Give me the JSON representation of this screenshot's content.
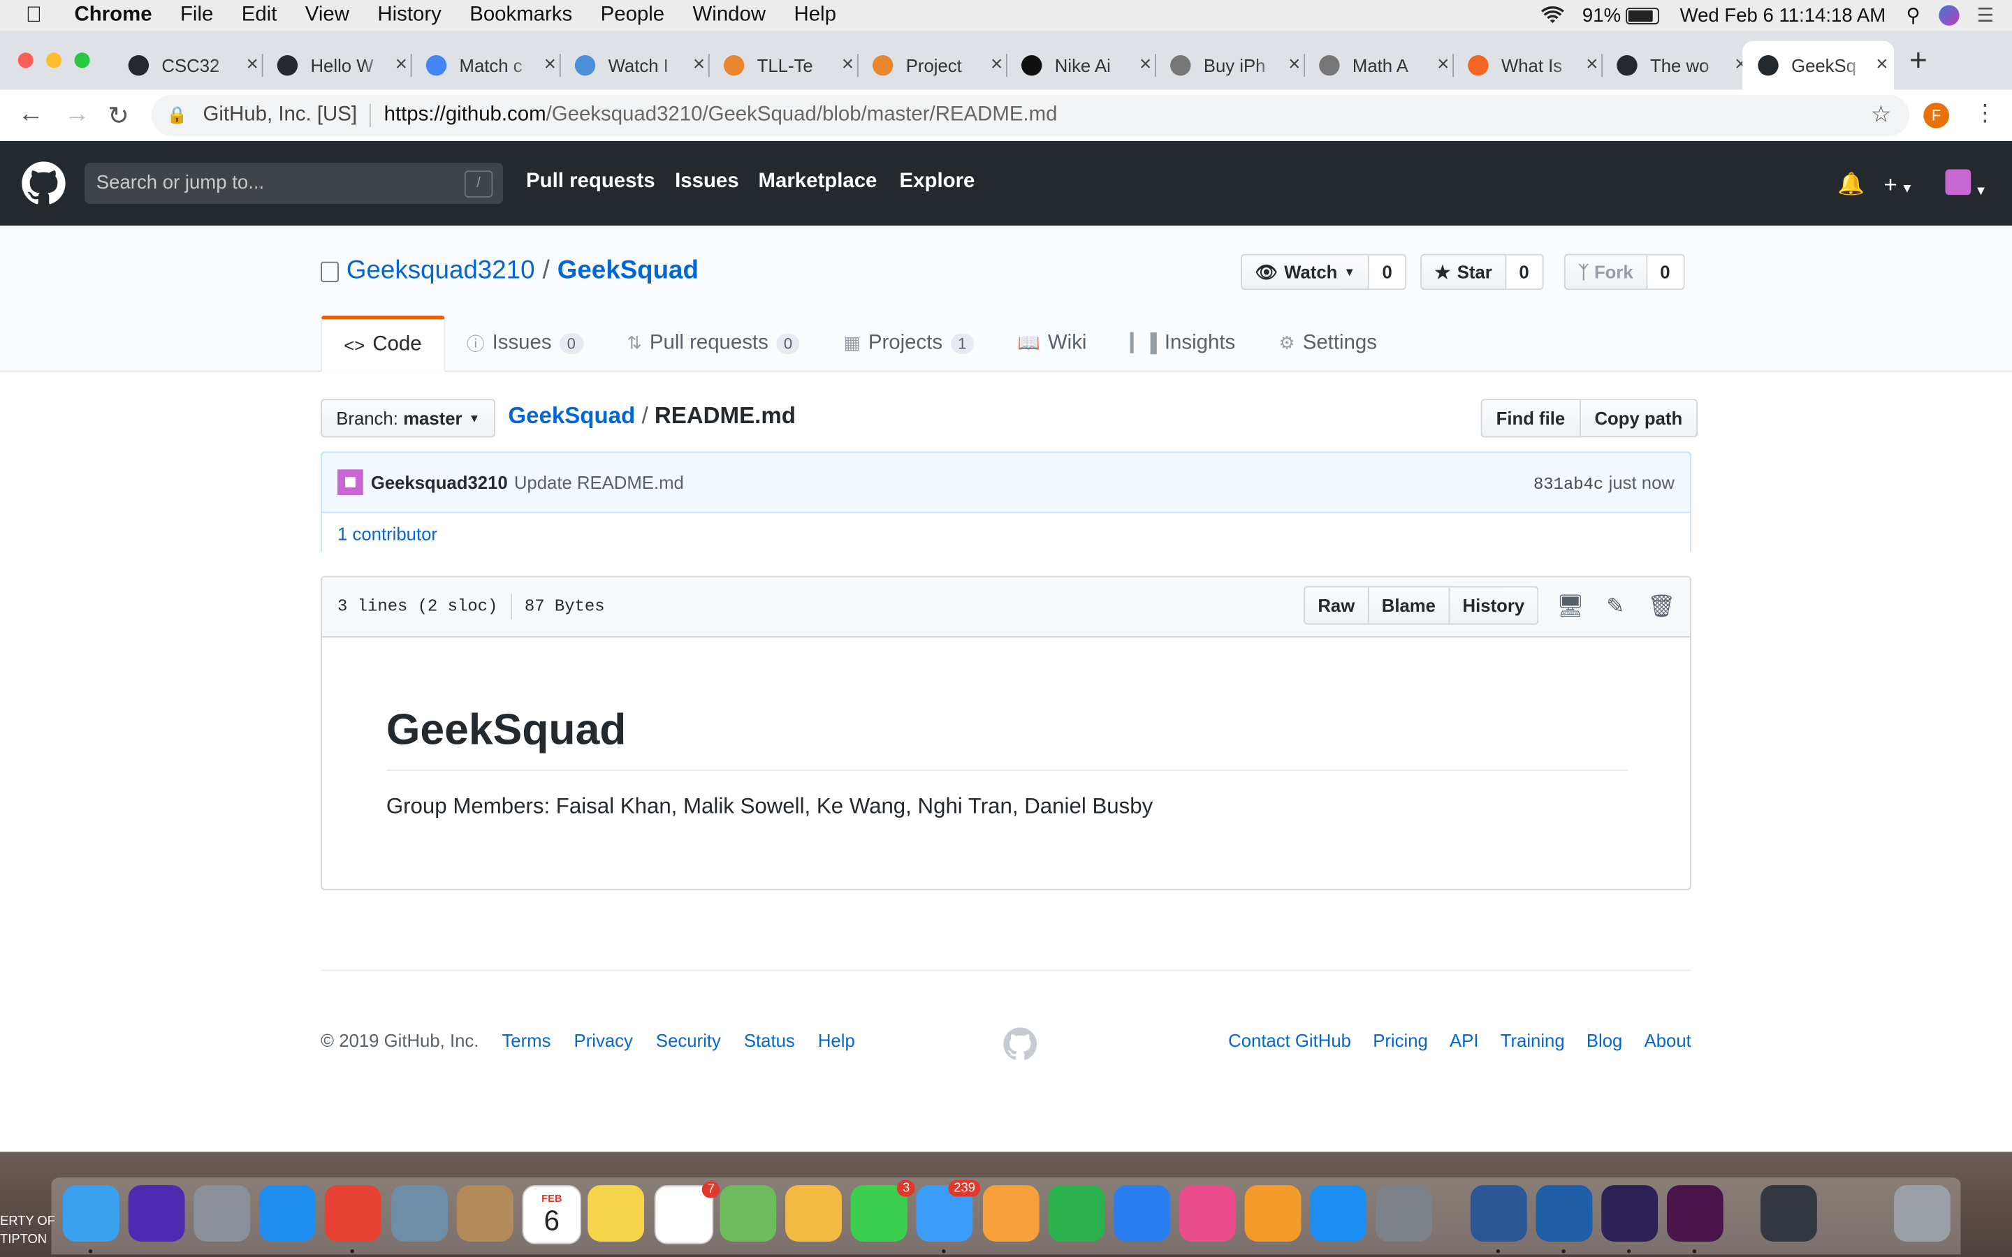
{
  "menubar": {
    "app": "Chrome",
    "items": [
      "File",
      "Edit",
      "View",
      "History",
      "Bookmarks",
      "People",
      "Window",
      "Help"
    ],
    "battery": "91%",
    "datetime": "Wed Feb 6  11:14:18 AM"
  },
  "tabs": [
    {
      "title": "CSC32",
      "icon": "github-icon",
      "color": "#24292e"
    },
    {
      "title": "Hello W",
      "icon": "github-icon",
      "color": "#24292e"
    },
    {
      "title": "Match c",
      "icon": "google-icon",
      "color": "#4285f4"
    },
    {
      "title": "Watch I",
      "icon": "play-icon",
      "color": "#4a90d9"
    },
    {
      "title": "TLL-Te",
      "icon": "b-icon",
      "color": "#e8872d"
    },
    {
      "title": "Project",
      "icon": "b-icon",
      "color": "#e8872d"
    },
    {
      "title": "Nike Ai",
      "icon": "nike-icon",
      "color": "#111111"
    },
    {
      "title": "Buy iPh",
      "icon": "apple-icon",
      "color": "#777777"
    },
    {
      "title": "Math A",
      "icon": "doc-icon",
      "color": "#777777"
    },
    {
      "title": "What Is",
      "icon": "c-icon",
      "color": "#f26522"
    },
    {
      "title": "The wo",
      "icon": "github-icon",
      "color": "#24292e"
    },
    {
      "title": "GeekSq",
      "icon": "github-icon",
      "color": "#24292e"
    }
  ],
  "omnibox": {
    "org": "GitHub, Inc. [US]",
    "host": "https://github.com",
    "path": "/Geeksquad3210/GeekSquad/blob/master/README.md",
    "profile": "F"
  },
  "github": {
    "search_placeholder": "Search or jump to...",
    "search_key": "/",
    "nav": [
      "Pull requests",
      "Issues",
      "Marketplace",
      "Explore"
    ]
  },
  "repo": {
    "owner": "Geeksquad3210",
    "name": "GeekSquad",
    "watch_label": "Watch",
    "watch_count": "0",
    "star_label": "Star",
    "star_count": "0",
    "fork_label": "Fork",
    "fork_count": "0",
    "tabs": [
      {
        "label": "Code",
        "icon": "code-icon",
        "count": ""
      },
      {
        "label": "Issues",
        "icon": "issue-icon",
        "count": "0"
      },
      {
        "label": "Pull requests",
        "icon": "pr-icon",
        "count": "0"
      },
      {
        "label": "Projects",
        "icon": "project-icon",
        "count": "1"
      },
      {
        "label": "Wiki",
        "icon": "book-icon",
        "count": ""
      },
      {
        "label": "Insights",
        "icon": "graph-icon",
        "count": ""
      },
      {
        "label": "Settings",
        "icon": "gear-icon",
        "count": ""
      }
    ]
  },
  "file": {
    "branch_prefix": "Branch:",
    "branch": "master",
    "crumb_repo": "GeekSquad",
    "crumb_file": "README.md",
    "find_file": "Find file",
    "copy_path": "Copy path",
    "commit_author": "Geeksquad3210",
    "commit_message": "Update README.md",
    "commit_sha": "831ab4c",
    "commit_time": "just now",
    "contributors": "1 contributor",
    "lines": "3 lines (2 sloc)",
    "size": "87 Bytes",
    "raw": "Raw",
    "blame": "Blame",
    "history": "History"
  },
  "readme": {
    "heading": "GeekSquad",
    "body": "Group Members: Faisal Khan, Malik Sowell, Ke Wang, Nghi Tran, Daniel Busby"
  },
  "footer": {
    "copyright": "© 2019 GitHub, Inc.",
    "left_links": [
      "Terms",
      "Privacy",
      "Security",
      "Status",
      "Help"
    ],
    "right_links": [
      "Contact GitHub",
      "Pricing",
      "API",
      "Training",
      "Blog",
      "About"
    ]
  },
  "dock": {
    "badges": {
      "reminders": "7",
      "facetime": "3",
      "messages": "239"
    },
    "calendar_month": "FEB",
    "calendar_day": "6",
    "desktop_text_1": "ERTY OF",
    "desktop_text_2": "TIPTON"
  }
}
